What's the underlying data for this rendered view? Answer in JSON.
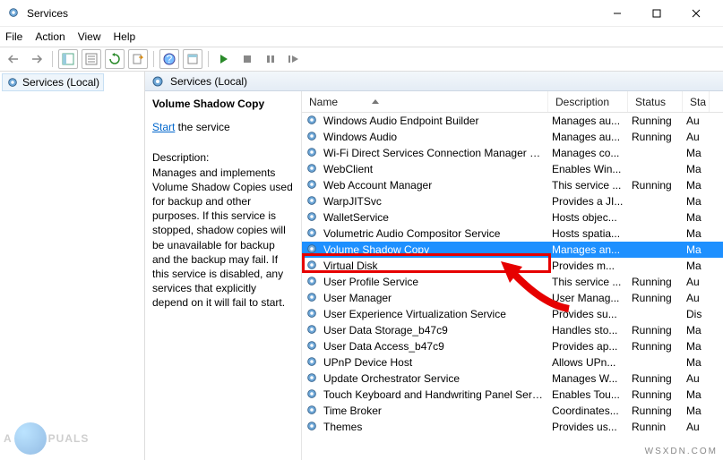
{
  "window": {
    "title": "Services"
  },
  "menu": {
    "file": "File",
    "action": "Action",
    "view": "View",
    "help": "Help"
  },
  "tree": {
    "root": "Services (Local)"
  },
  "heading": "Services (Local)",
  "panel": {
    "title": "Volume Shadow Copy",
    "start_label": "Start",
    "start_suffix": " the service",
    "desc_header": "Description:",
    "description": "Manages and implements Volume Shadow Copies used for backup and other purposes. If this service is stopped, shadow copies will be unavailable for backup and the backup may fail. If this service is disabled, any services that explicitly depend on it will fail to start."
  },
  "columns": {
    "name": "Name",
    "desc": "Description",
    "status": "Status",
    "startup": "Sta"
  },
  "rows": [
    {
      "name": "Windows Audio Endpoint Builder",
      "desc": "Manages au...",
      "status": "Running",
      "startup": "Au"
    },
    {
      "name": "Windows Audio",
      "desc": "Manages au...",
      "status": "Running",
      "startup": "Au"
    },
    {
      "name": "Wi-Fi Direct Services Connection Manager Ser...",
      "desc": "Manages co...",
      "status": "",
      "startup": "Ma"
    },
    {
      "name": "WebClient",
      "desc": "Enables Win...",
      "status": "",
      "startup": "Ma"
    },
    {
      "name": "Web Account Manager",
      "desc": "This service ...",
      "status": "Running",
      "startup": "Ma"
    },
    {
      "name": "WarpJITSvc",
      "desc": "Provides a JI...",
      "status": "",
      "startup": "Ma"
    },
    {
      "name": "WalletService",
      "desc": "Hosts objec...",
      "status": "",
      "startup": "Ma"
    },
    {
      "name": "Volumetric Audio Compositor Service",
      "desc": "Hosts spatia...",
      "status": "",
      "startup": "Ma"
    },
    {
      "name": "Volume Shadow Copy",
      "desc": "Manages an...",
      "status": "",
      "startup": "Ma",
      "selected": true
    },
    {
      "name": "Virtual Disk",
      "desc": "Provides m...",
      "status": "",
      "startup": "Ma"
    },
    {
      "name": "User Profile Service",
      "desc": "This service ...",
      "status": "Running",
      "startup": "Au"
    },
    {
      "name": "User Manager",
      "desc": "User Manag...",
      "status": "Running",
      "startup": "Au"
    },
    {
      "name": "User Experience Virtualization Service",
      "desc": "Provides su...",
      "status": "",
      "startup": "Dis"
    },
    {
      "name": "User Data Storage_b47c9",
      "desc": "Handles sto...",
      "status": "Running",
      "startup": "Ma"
    },
    {
      "name": "User Data Access_b47c9",
      "desc": "Provides ap...",
      "status": "Running",
      "startup": "Ma"
    },
    {
      "name": "UPnP Device Host",
      "desc": "Allows UPn...",
      "status": "",
      "startup": "Ma"
    },
    {
      "name": "Update Orchestrator Service",
      "desc": "Manages W...",
      "status": "Running",
      "startup": "Au"
    },
    {
      "name": "Touch Keyboard and Handwriting Panel Service",
      "desc": "Enables Tou...",
      "status": "Running",
      "startup": "Ma"
    },
    {
      "name": "Time Broker",
      "desc": "Coordinates...",
      "status": "Running",
      "startup": "Ma"
    },
    {
      "name": "Themes",
      "desc": "Provides us...",
      "status": "Runnin",
      "startup": "Au"
    }
  ],
  "watermark": {
    "prefix": "A",
    "suffix": "PUALS"
  },
  "brand": "wsxdn.com"
}
